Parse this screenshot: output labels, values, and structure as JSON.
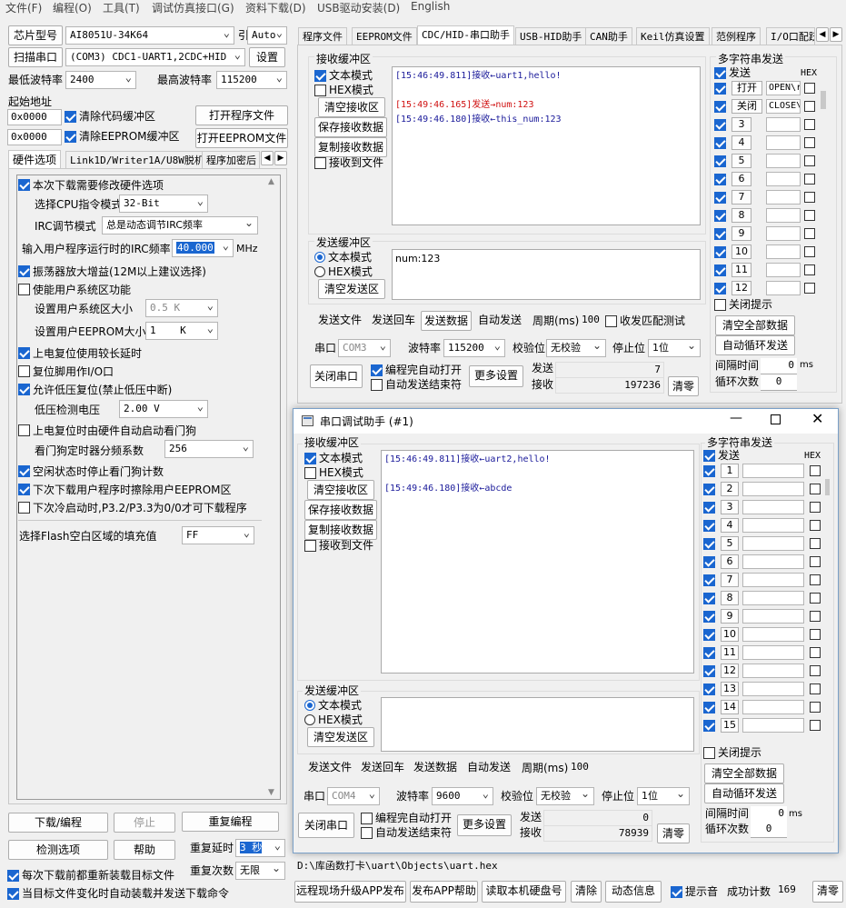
{
  "menu": [
    "文件(F)",
    "编程(O)",
    "工具(T)",
    "调试仿真接口(G)",
    "资料下载(D)",
    "USB驱动安装(D)",
    "English"
  ],
  "left": {
    "chip_label": "芯片型号",
    "chip_value": "AI8051U-34K64",
    "pin_label": "引脚数",
    "pin_value": "Auto",
    "scan_label": "扫描串口",
    "port_value": "(COM3) CDC1-UART1,2CDC+HID",
    "settings_label": "设置",
    "min_baud_label": "最低波特率",
    "min_baud_value": "2400",
    "max_baud_label": "最高波特率",
    "max_baud_value": "115200",
    "start_addr_label": "起始地址",
    "addr1": "0x0000",
    "clear_code_label": "清除代码缓冲区",
    "open_prog_label": "打开程序文件",
    "addr2": "0x0000",
    "clear_eeprom_label": "清除EEPROM缓冲区",
    "open_eeprom_label": "打开EEPROM文件",
    "tabs": [
      "硬件选项",
      "Link1D/Writer1A/U8W脱机",
      "程序加密后"
    ],
    "hw_opt": {
      "modify_hw": "本次下载需要修改硬件选项",
      "cpu_mode_label": "选择CPU指令模式",
      "cpu_mode_value": "32-Bit",
      "irc_mode_label": "IRC调节模式",
      "irc_mode_value": "总是动态调节IRC频率",
      "irc_freq_label": "输入用户程序运行时的IRC频率",
      "irc_freq_value": "40.000",
      "irc_unit": "MHz",
      "osc_gain": "振荡器放大增益(12M以上建议选择)",
      "sys_area": "使能用户系统区功能",
      "sys_size_label": "设置用户系统区大小",
      "sys_size_value": "0.5 K",
      "eeprom_size_label": "设置用户EEPROM大小",
      "eeprom_size_value": "1    K",
      "long_delay": "上电复位使用较长延时",
      "reset_io": "复位脚用作I/O口",
      "lvr": "允许低压复位(禁止低压中断)",
      "lvd_label": "低压检测电压",
      "lvd_value": "2.00 V",
      "wdt_auto": "上电复位时由硬件自动启动看门狗",
      "wdt_div_label": "看门狗定时器分频系数",
      "wdt_div_value": "256",
      "idle_wdt": "空闲状态时停止看门狗计数",
      "erase_eeprom": "下次下载用户程序时擦除用户EEPROM区",
      "cold_boot": "下次冷启动时,P3.2/P3.3为0/0才可下载程序",
      "flash_fill_label": "选择Flash空白区域的填充值",
      "flash_fill_value": "FF"
    },
    "download_label": "下载/编程",
    "stop_label": "停止",
    "reprogram_label": "重复编程",
    "check_label": "检测选项",
    "help_label": "帮助",
    "repeat_delay_label": "重复延时",
    "repeat_delay_value": "3 秒",
    "repeat_count_label": "重复次数",
    "repeat_count_value": "无限",
    "reload_label": "每次下载前都重新装载目标文件",
    "autoload_label": "当目标文件变化时自动装载并发送下载命令"
  },
  "right_tabs": [
    "程序文件",
    "EEPROM文件",
    "CDC/HID-串口助手",
    "USB-HID助手",
    "CAN助手",
    "Keil仿真设置",
    "范例程序",
    "I/O口配跃"
  ],
  "main_serial": {
    "rx_title": "接收缓冲区",
    "text_mode": "文本模式",
    "hex_mode": "HEX模式",
    "clear_rx": "清空接收区",
    "save_rx": "保存接收数据",
    "copy_rx": "复制接收数据",
    "rx_to_file": "接收到文件",
    "rx_lines": [
      {
        "time": "[15:46:49.811]",
        "dir": "接收←",
        "text": "uart1,hello!",
        "color": "#1a1a9a"
      },
      {
        "time": "",
        "dir": "",
        "text": "",
        "color": "#000"
      },
      {
        "time": "[15:49:46.165]",
        "dir": "发送→",
        "text": "num:123",
        "color": "#d01010"
      },
      {
        "time": "[15:49:46.180]",
        "dir": "接收←",
        "text": "this_num:123",
        "color": "#1a1a9a"
      }
    ],
    "tx_title": "发送缓冲区",
    "tx_text": "num:123",
    "clear_tx": "清空发送区",
    "send_file": "发送文件",
    "send_return": "发送回车",
    "send_data": "发送数据",
    "auto_send": "自动发送",
    "period_label": "周期(ms)",
    "period_value": "100",
    "match_label": "收发匹配测试",
    "port_label": "串口",
    "port_value": "COM3",
    "baud_label": "波特率",
    "baud_value": "115200",
    "parity_label": "校验位",
    "parity_value": "无校验",
    "stop_label": "停止位",
    "stop_value": "1位",
    "close_port": "关闭串口",
    "auto_open": "编程完自动打开",
    "auto_end": "自动发送结束符",
    "more": "更多设置",
    "send_count_label": "发送",
    "send_count": "7",
    "recv_count_label": "接收",
    "recv_count": "197236",
    "clear_count": "清零",
    "multi_title": "多字符串发送",
    "send_col": "发送",
    "hex_col": "HEX",
    "rows": [
      {
        "n": "打开",
        "v": "OPEN\\r"
      },
      {
        "n": "关闭",
        "v": "CLOSE\\"
      },
      {
        "n": "3",
        "v": ""
      },
      {
        "n": "4",
        "v": ""
      },
      {
        "n": "5",
        "v": ""
      },
      {
        "n": "6",
        "v": ""
      },
      {
        "n": "7",
        "v": ""
      },
      {
        "n": "8",
        "v": ""
      },
      {
        "n": "9",
        "v": ""
      },
      {
        "n": "10",
        "v": ""
      },
      {
        "n": "11",
        "v": ""
      },
      {
        "n": "12",
        "v": ""
      }
    ],
    "close_tip": "关闭提示",
    "clear_all": "清空全部数据",
    "auto_loop": "自动循环发送",
    "interval_label": "间隔时间",
    "interval_value": "0",
    "interval_unit": "ms",
    "loop_label": "循环次数",
    "loop_value": "0"
  },
  "win2": {
    "title": "串口调试助手 (#1)",
    "rx_title": "接收缓冲区",
    "text_mode": "文本模式",
    "hex_mode": "HEX模式",
    "clear_rx": "清空接收区",
    "save_rx": "保存接收数据",
    "copy_rx": "复制接收数据",
    "rx_to_file": "接收到文件",
    "rx_lines": [
      {
        "time": "[15:46:49.811]",
        "dir": "接收←",
        "text": "uart2,hello!"
      },
      {
        "time": "",
        "dir": "",
        "text": ""
      },
      {
        "time": "[15:49:46.180]",
        "dir": "接收←",
        "text": "abcde"
      }
    ],
    "tx_title": "发送缓冲区",
    "clear_tx": "清空发送区",
    "send_file": "发送文件",
    "send_return": "发送回车",
    "send_data": "发送数据",
    "auto_send": "自动发送",
    "period_label": "周期(ms)",
    "period_value": "100",
    "port_label": "串口",
    "port_value": "COM4",
    "baud_label": "波特率",
    "baud_value": "9600",
    "parity_label": "校验位",
    "parity_value": "无校验",
    "stop_label": "停止位",
    "stop_value": "1位",
    "close_port": "关闭串口",
    "auto_open": "编程完自动打开",
    "auto_end": "自动发送结束符",
    "more": "更多设置",
    "send_count_label": "发送",
    "send_count": "0",
    "recv_count_label": "接收",
    "recv_count": "78939",
    "clear_count": "清零",
    "multi_title": "多字符串发送",
    "send_col": "发送",
    "hex_col": "HEX",
    "rows": [
      "1",
      "2",
      "3",
      "4",
      "5",
      "6",
      "7",
      "8",
      "9",
      "10",
      "11",
      "12",
      "13",
      "14",
      "15"
    ],
    "close_tip": "关闭提示",
    "clear_all": "清空全部数据",
    "auto_loop": "自动循环发送",
    "interval_label": "间隔时间",
    "interval_value": "0",
    "interval_unit": "ms",
    "loop_label": "循环次数",
    "loop_value": "0"
  },
  "status": {
    "path": "D:\\库函数打卡\\uart\\Objects\\uart.hex",
    "remote_upgrade": "远程现场升级APP发布",
    "publish_help": "发布APP帮助",
    "read_disk": "读取本机硬盘号",
    "clear": "清除",
    "dynamic_info": "动态信息",
    "beep": "提示音",
    "success_label": "成功计数",
    "success_count": "169",
    "clear_zero": "清零"
  }
}
